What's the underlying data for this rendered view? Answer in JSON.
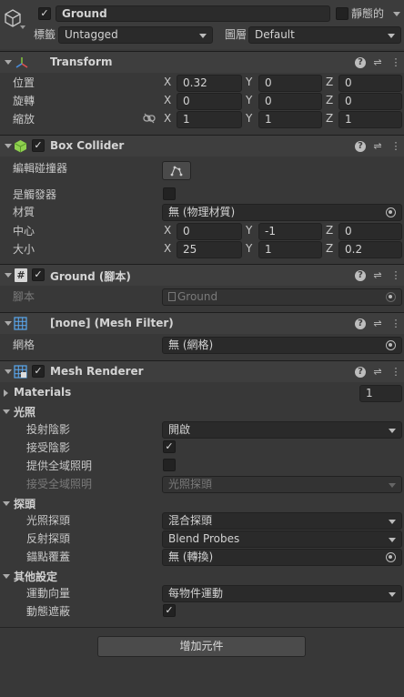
{
  "gameobject": {
    "name": "Ground",
    "static_label": "靜態的",
    "tag_label": "標籤",
    "tag_value": "Untagged",
    "layer_label": "圖層",
    "layer_value": "Default"
  },
  "transform": {
    "title": "Transform",
    "position_label": "位置",
    "rotation_label": "旋轉",
    "scale_label": "縮放",
    "position": {
      "x": "0.32",
      "y": "0",
      "z": "0"
    },
    "rotation": {
      "x": "0",
      "y": "0",
      "z": "0"
    },
    "scale": {
      "x": "1",
      "y": "1",
      "z": "1"
    }
  },
  "axes": {
    "x": "X",
    "y": "Y",
    "z": "Z"
  },
  "box_collider": {
    "title": "Box Collider",
    "edit_label": "編輯碰撞器",
    "trigger_label": "是觸發器",
    "material_label": "材質",
    "material_value": "無 (物理材質)",
    "center_label": "中心",
    "size_label": "大小",
    "center": {
      "x": "0",
      "y": "-1",
      "z": "0"
    },
    "size": {
      "x": "25",
      "y": "1",
      "z": "0.2"
    }
  },
  "script": {
    "title": "Ground (腳本)",
    "script_label": "腳本",
    "script_value": "Ground"
  },
  "mesh_filter": {
    "title": "[none] (Mesh Filter)",
    "mesh_label": "網格",
    "mesh_value": "無 (網格)"
  },
  "mesh_renderer": {
    "title": "Mesh Renderer",
    "materials_label": "Materials",
    "materials_count": "1",
    "lighting_title": "光照",
    "cast_shadows_label": "投射陰影",
    "cast_shadows_value": "開啟",
    "receive_shadows_label": "接受陰影",
    "contribute_gi_label": "提供全域照明",
    "receive_gi_label": "接受全域照明",
    "receive_gi_value": "光照探頭",
    "probes_title": "探頭",
    "light_probes_label": "光照探頭",
    "light_probes_value": "混合探頭",
    "reflection_probes_label": "反射探頭",
    "reflection_probes_value": "Blend Probes",
    "anchor_override_label": "錨點覆蓋",
    "anchor_override_value": "無 (轉換)",
    "additional_title": "其他設定",
    "motion_vectors_label": "運動向量",
    "motion_vectors_value": "每物件運動",
    "dynamic_occlusion_label": "動態遮蔽"
  },
  "add_component_label": "增加元件",
  "colors": {
    "background": "#383838",
    "header": "#3e3e3e",
    "field": "#2a2a2a"
  }
}
